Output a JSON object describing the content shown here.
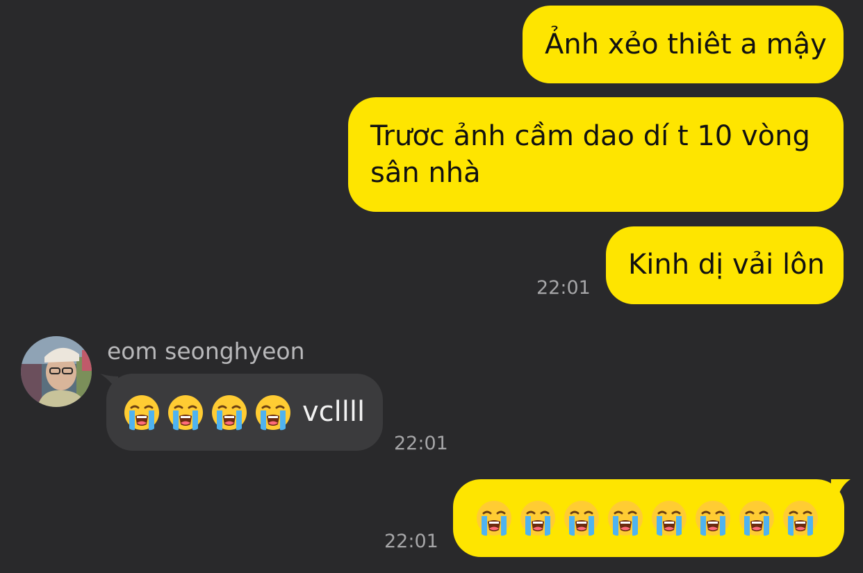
{
  "messages": [
    {
      "id": "m1",
      "sender": "me",
      "text": "Ảnh xẻo thiêt a mậy"
    },
    {
      "id": "m2",
      "sender": "me",
      "text": "Trươc ảnh cầm dao dí t 10 vòng sân nhà"
    },
    {
      "id": "m3",
      "sender": "me",
      "text": "Kinh dị vải lôn",
      "time": "22:01"
    },
    {
      "id": "m4",
      "sender": "eom seonghyeon",
      "emoji": "crying-face",
      "emoji_count": 4,
      "text": "vcllll",
      "time": "22:01"
    },
    {
      "id": "m5",
      "sender": "me",
      "emoji": "crying-face",
      "emoji_count": 8,
      "time": "22:01"
    }
  ],
  "contact": {
    "name": "eom seonghyeon",
    "avatar_icon": "avatar-photo"
  },
  "colors": {
    "background": "#29292b",
    "my_bubble": "#fee500",
    "their_bubble": "#3b3b3d",
    "time_text": "#a6a6a8"
  }
}
